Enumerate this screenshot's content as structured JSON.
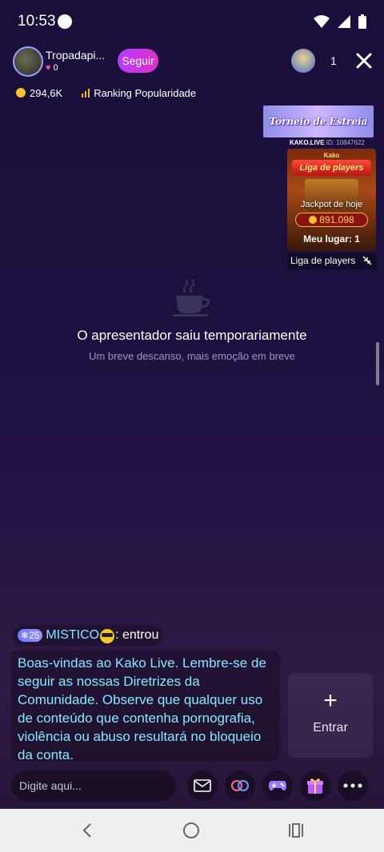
{
  "status_bar": {
    "time": "10:53"
  },
  "host": {
    "name": "Tropadapi...",
    "likes": "0",
    "follow_label": "Seguir",
    "viewer_count": "1"
  },
  "stats": {
    "coins": "294,6K",
    "ranking_label": "Ranking Popularidade"
  },
  "tournament": {
    "banner_text": "Torneio de Estreia",
    "brand": "KAKO.LIVE",
    "id_text": "ID: 10847622"
  },
  "league": {
    "brand": "Kako",
    "title": "Liga de players",
    "jackpot_label": "Jackpot de hoje",
    "jackpot_value": "891.098",
    "my_place": "Meu lugar: 1",
    "bar_label": "Liga de players"
  },
  "away": {
    "title": "O apresentador saiu temporariamente",
    "subtitle": "Um breve descanso, mais emoção em breve"
  },
  "chat": {
    "join_level": "25",
    "join_user": "MISTICO",
    "join_action": ": entrou",
    "welcome": "Boas-vindas ao Kako Live. Lembre-se de seguir as nossas Diretrizes da Comunidade. Observe que qualquer uso de conteúdo que contenha pornografia, violência ou abuso resultará no bloqueio da conta."
  },
  "enter_button": {
    "label": "Entrar"
  },
  "input": {
    "placeholder": "Digite aqui..."
  },
  "colors": {
    "accent": "#c33cf0",
    "chat_text": "#84e8ff",
    "coin": "#f2c232"
  }
}
